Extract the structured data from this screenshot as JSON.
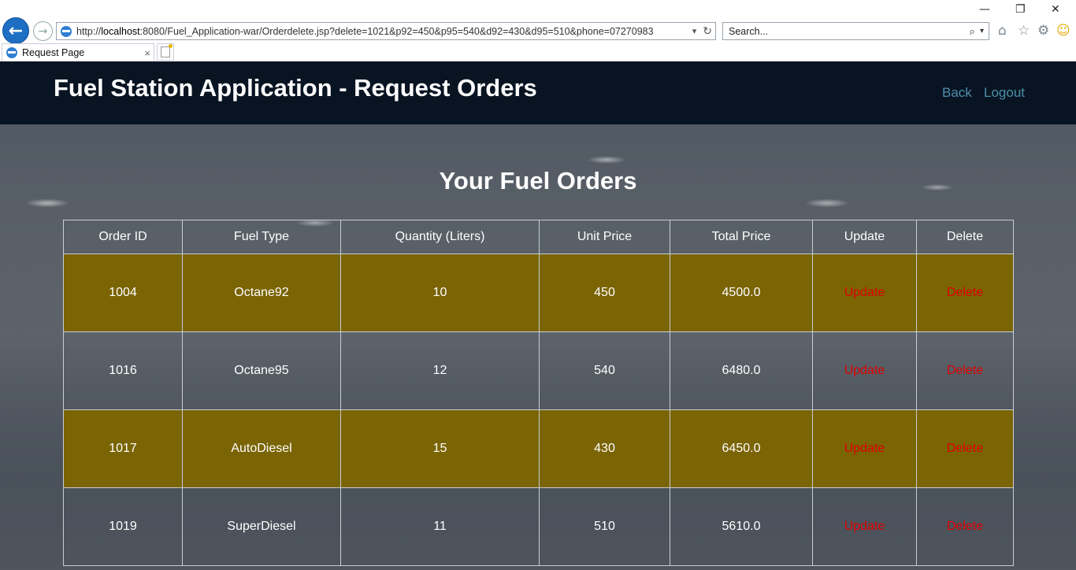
{
  "browser": {
    "url_prefix": "http://",
    "url_host": "localhost",
    "url_rest": ":8080/Fuel_Application-war/Orderdelete.jsp?delete=1021&p92=450&p95=540&d92=430&d95=510&phone=07270983",
    "search_placeholder": "Search...",
    "tab_title": "Request Page",
    "minimize": "—",
    "restore": "❐",
    "close": "✕",
    "back_glyph": "←",
    "forward_glyph": "→",
    "tab_close": "×",
    "dropdown_glyph": "▾",
    "refresh_glyph": "↻",
    "search_glyph": "⌕",
    "home_glyph": "⌂",
    "star_glyph": "☆",
    "gear_glyph": "⚙",
    "smiley_glyph": "☺"
  },
  "navbar": {
    "title": "Fuel Station Application - Request Orders",
    "back_label": "Back",
    "logout_label": "Logout"
  },
  "main": {
    "heading": "Your Fuel Orders"
  },
  "table": {
    "headers": [
      "Order ID",
      "Fuel Type",
      "Quantity (Liters)",
      "Unit Price",
      "Total Price",
      "Update",
      "Delete"
    ],
    "rows": [
      {
        "order_id": "1004",
        "fuel_type": "Octane92",
        "quantity": "10",
        "unit_price": "450",
        "total_price": "4500.0",
        "update": "Update",
        "delete": "Delete"
      },
      {
        "order_id": "1016",
        "fuel_type": "Octane95",
        "quantity": "12",
        "unit_price": "540",
        "total_price": "6480.0",
        "update": "Update",
        "delete": "Delete"
      },
      {
        "order_id": "1017",
        "fuel_type": "AutoDiesel",
        "quantity": "15",
        "unit_price": "430",
        "total_price": "6450.0",
        "update": "Update",
        "delete": "Delete"
      },
      {
        "order_id": "1019",
        "fuel_type": "SuperDiesel",
        "quantity": "11",
        "unit_price": "510",
        "total_price": "5610.0",
        "update": "Update",
        "delete": "Delete"
      }
    ]
  },
  "colors": {
    "navbar_bg": "#081422",
    "row_highlight": "#7a6404",
    "link_red": "#e00000",
    "nav_link": "#4d8fa9"
  }
}
